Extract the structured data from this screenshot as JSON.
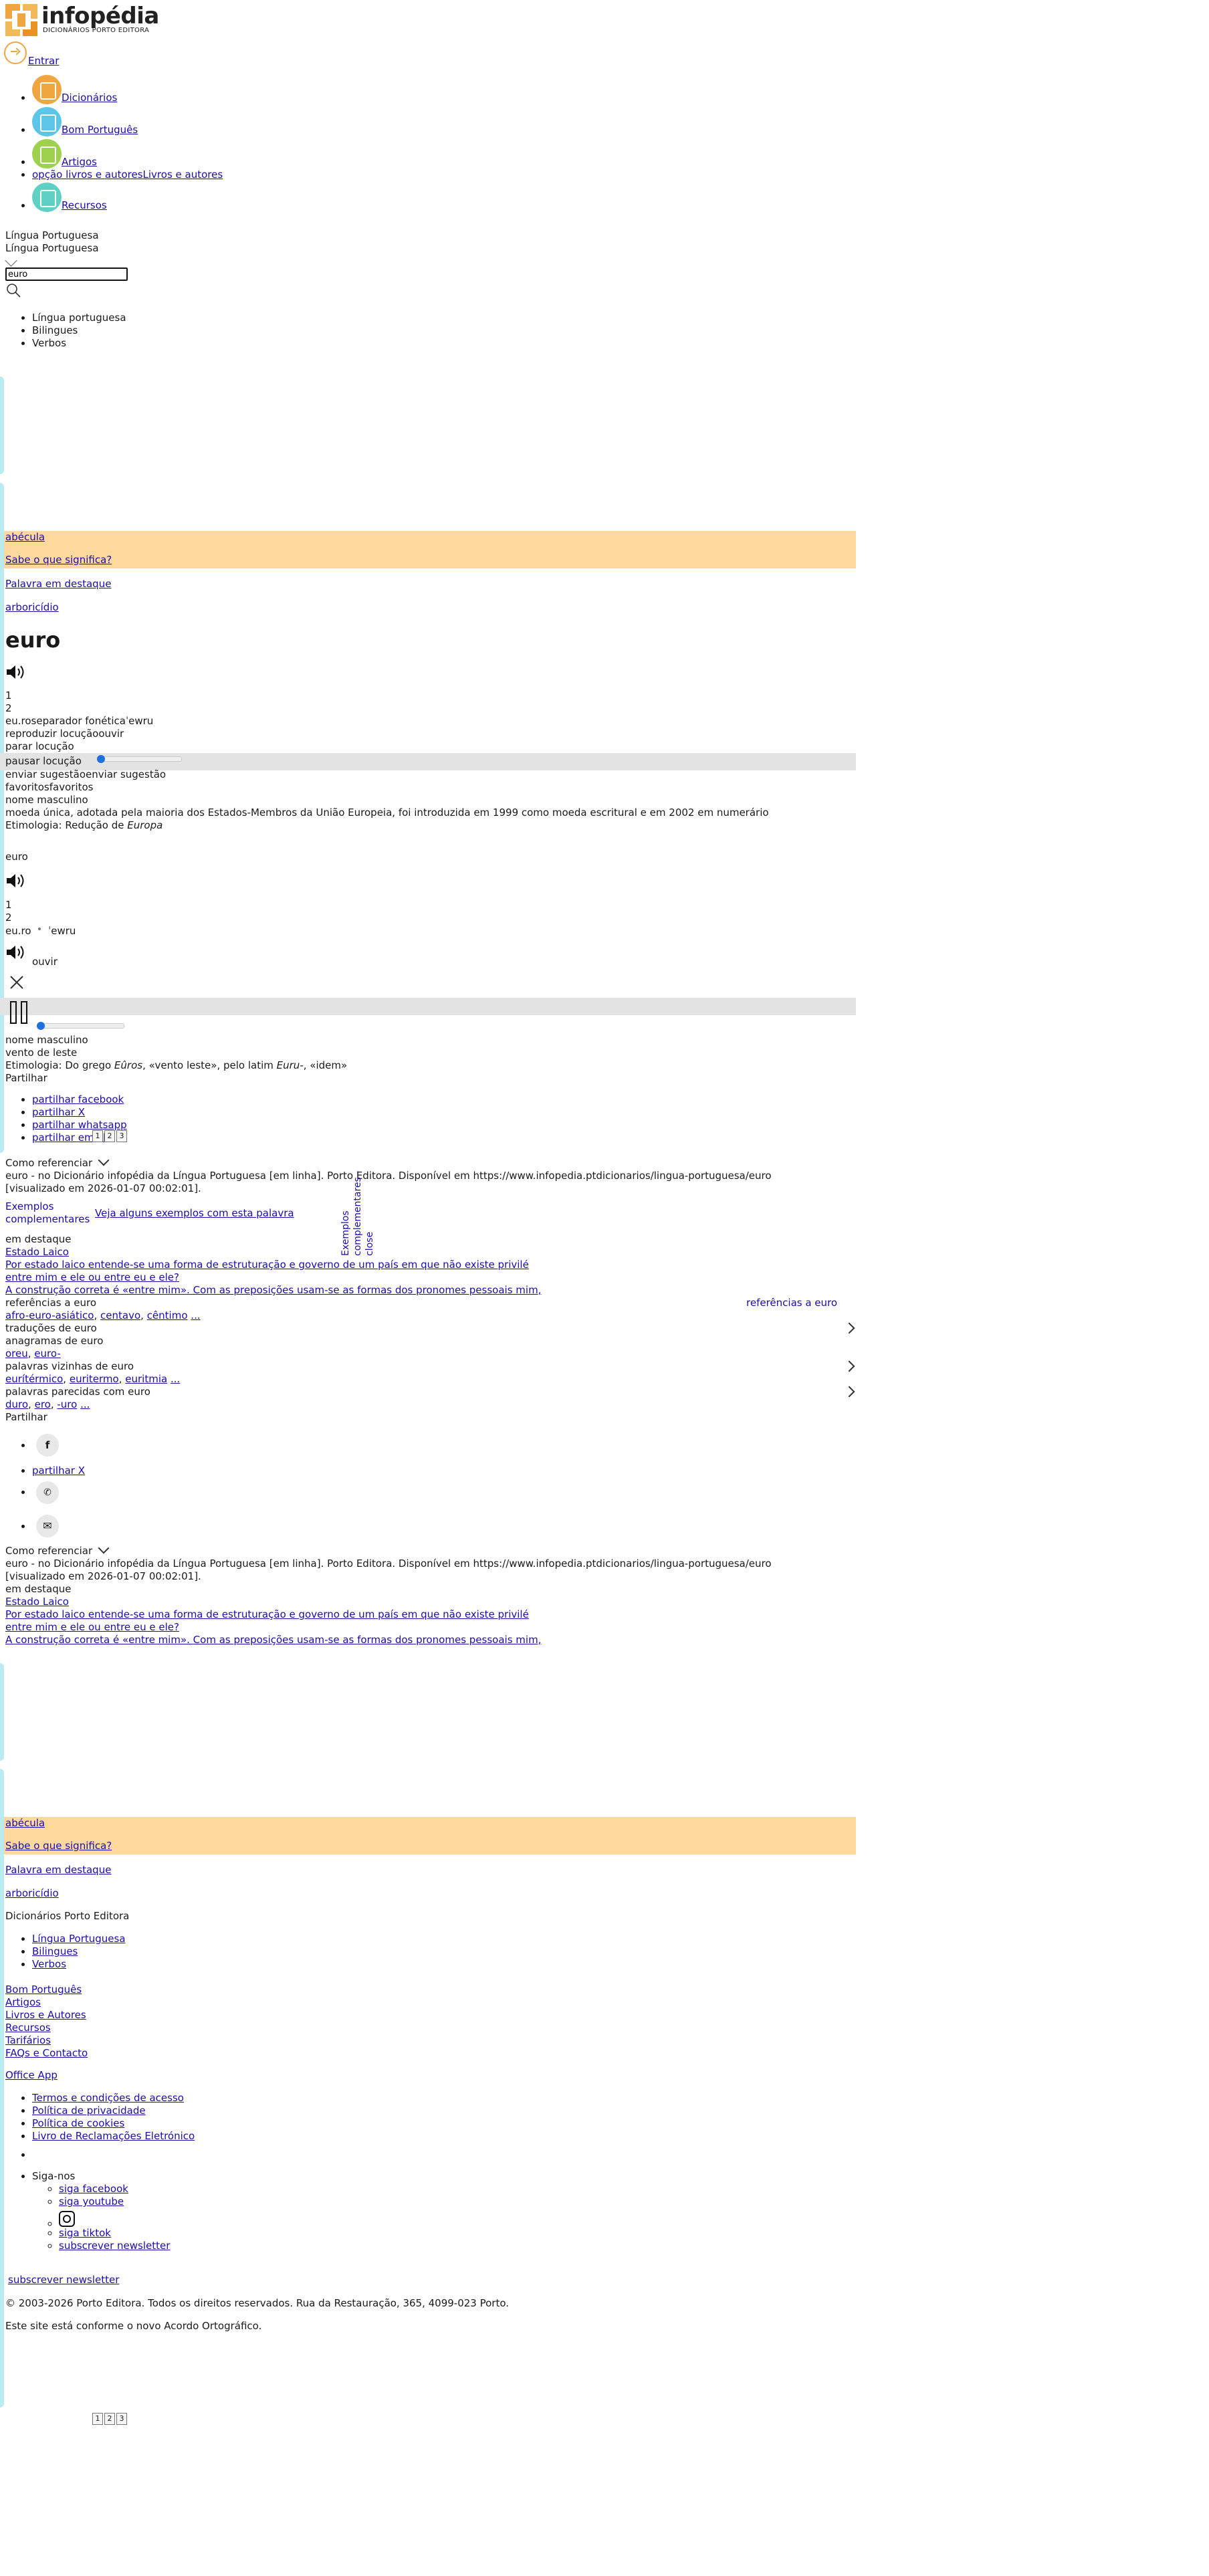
{
  "brand": {
    "name": "infopédia",
    "subtitle": "DICIONÁRIOS PORTO EDITORA"
  },
  "header": {
    "login_label": "Entrar"
  },
  "nav": {
    "items": [
      {
        "label": "Dicionários",
        "color": "#f0a640"
      },
      {
        "label": "Bom Português",
        "color": "#5cc5e8"
      },
      {
        "label": "Artigos",
        "color": "#9ed14e"
      },
      {
        "label": "Livros e autores",
        "img_alt": "opção livros e autores"
      },
      {
        "label": "Recursos",
        "color": "#5fd1c4"
      }
    ]
  },
  "search": {
    "language_label": "Língua Portuguesa",
    "language_selected": "Língua Portuguesa",
    "query": "euro",
    "dropdown_options": [
      "Língua portuguesa",
      "Bilingues",
      "Verbos"
    ]
  },
  "promo": {
    "word1": "abécula",
    "word1_prompt": "Sabe o que significa?",
    "featured_label": "Palavra em destaque",
    "featured_word": "arboricídio"
  },
  "entry1": {
    "headword": "euro",
    "sense_nums": [
      "1",
      "2"
    ],
    "syllables": "eu.ro",
    "phon_sep_alt": "separador fonética",
    "pron": "ˈewru",
    "play_alt": "reproduzir locução",
    "listen": "ouvir",
    "stop_alt": "parar locução",
    "pause_alt": "pausar locução",
    "suggest_alt": "enviar sugestão",
    "suggest": "enviar sugestão",
    "fav_alt": "favoritos",
    "fav": "favoritos",
    "pos": "nome masculino",
    "definition": "moeda única, adotada pela maioria dos Estados-Membros da União Europeia, foi introduzida em 1999 como moeda escritural e em 2002 em numerário",
    "etym_prefix": "Etimologia: Redução de ",
    "etym_word": "Europa"
  },
  "entry2": {
    "headword": "euro",
    "sense_nums": [
      "1",
      "2"
    ],
    "syllables": "eu.ro",
    "pron": "ˈewru",
    "listen": "ouvir",
    "pos": "nome masculino",
    "definition": "vento de leste",
    "etym_prefix": "Etimologia: Do grego ",
    "etym_w1": "Eûros",
    "etym_mid": ", «vento leste», pelo latim ",
    "etym_w2": "Euru-",
    "etym_end": ", «idem»"
  },
  "share": {
    "label": "Partilhar",
    "items": [
      "partilhar facebook",
      "partilhar X",
      "partilhar whatsapp",
      "partilhar email"
    ]
  },
  "reference": {
    "label": "Como referenciar",
    "text_a": "euro - no Dicionário infopédia da Língua Portuguesa [em linha]. Porto Editora. Disponível em https://www.infopedia.ptdicionarios/lingua-portuguesa/euro",
    "text_b": "[visualizado em 2026-01-07 00:02:01]."
  },
  "examples": {
    "img_alt": "Exemplos complementares",
    "prompt": "Veja alguns exemplos com esta palavra",
    "vertical": "Exemplos complementares - close"
  },
  "highlight": {
    "label": "em destaque",
    "title": "Estado Laico",
    "link1": "Por estado laico entende-se uma forma de estruturação e governo de um país em que não existe privilé",
    "link2": "entre mim e ele ou entre eu e ele?",
    "link3": "A construção correta é «entre mim». Com as preposições usam-se as formas dos pronomes pessoais mim,"
  },
  "related": {
    "refs_label": "referências a euro",
    "refs_img_alt": "referências a euro",
    "refs": [
      "afro-euro-asiático",
      "centavo",
      "cêntimo",
      "..."
    ],
    "translations_label": "traduções de euro",
    "anagrams_label": "anagramas de euro",
    "anagrams": [
      "oreu",
      "euro-"
    ],
    "neighbors_label": "palavras vizinhas de euro",
    "neighbors": [
      "eurítérmico",
      "euritermo",
      "euritmia",
      "..."
    ],
    "similar_label": "palavras parecidas com euro",
    "similar": [
      "duro",
      "ero",
      "-uro",
      "..."
    ]
  },
  "pager": [
    "1",
    "2",
    "3"
  ],
  "footer": {
    "heading": "Dicionários Porto Editora",
    "dict_links": [
      "Língua Portuguesa",
      "Bilingues",
      "Verbos"
    ],
    "links": [
      "Bom Português",
      "Artigos",
      "Livros e Autores",
      "Recursos",
      "Tarifários",
      "FAQs e Contacto"
    ],
    "office": "Office App",
    "legal": [
      "Termos e condições de acesso",
      "Política de privacidade",
      "Política de cookies",
      "Livro de Reclamações Eletrónico"
    ],
    "follow": "Siga-nos",
    "social": [
      "siga facebook",
      "siga youtube",
      "siga tiktok"
    ],
    "newsletter": "subscrever newsletter",
    "newsletter2": "subscrever newsletter",
    "copyright": "© 2003-2026 Porto Editora. Todos os direitos reservados. Rua da Restauração, 365, 4099-023 Porto.",
    "ao": "Este site está conforme o novo Acordo Ortográfico."
  },
  "colors": {
    "accent": "#f0a640",
    "link": "#1a0dab",
    "promo_bg": "#fed89c",
    "side": "#b9ebf0"
  }
}
